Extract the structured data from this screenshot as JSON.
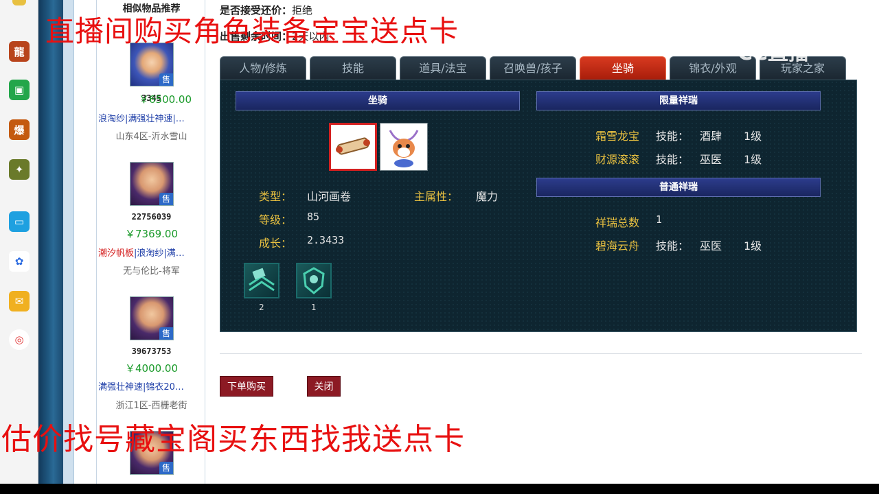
{
  "similar": {
    "title": "相似物品推荐",
    "sell_label": "售",
    "items": [
      {
        "id": "3345",
        "price": "￥6500.00",
        "tags_red": "",
        "tags": "浪淘纱|满强壮神速|…",
        "server": "山东4区-沂水雪山"
      },
      {
        "id": "22756039",
        "price": "￥7369.00",
        "tags_red": "潮汐帆板",
        "tags": "|浪淘纱|满…",
        "server": "无与伦比-将军"
      },
      {
        "id": "39673753",
        "price": "￥4000.00",
        "tags_red": "",
        "tags": "满强壮神速|锦衣20…",
        "server": "浙江1区-西栅老街"
      }
    ]
  },
  "header": {
    "bargain_label": "是否接受还价：",
    "bargain_value": "拒绝",
    "remain_label": "出售剩余时间：",
    "remain_value": "2天以内"
  },
  "tabs": [
    "人物/修炼",
    "技能",
    "道具/法宝",
    "召唤兽/孩子",
    "坐骑",
    "锦衣/外观",
    "玩家之家"
  ],
  "active_tab": "坐骑",
  "mount": {
    "section_title": "坐骑",
    "type_label": "类型：",
    "type_value": "山河画卷",
    "attr_label": "主属性：",
    "attr_value": "魔力",
    "level_label": "等级：",
    "level_value": "85",
    "growth_label": "成长：",
    "growth_value": "2.3433",
    "equip_counts": [
      "2",
      "1"
    ]
  },
  "limited": {
    "section_title": "限量祥瑞",
    "items": [
      {
        "name": "霜雪龙宝",
        "skill_label": "技能：",
        "skill": "酒肆",
        "level": "1级"
      },
      {
        "name": "财源滚滚",
        "skill_label": "技能：",
        "skill": "巫医",
        "level": "1级"
      }
    ]
  },
  "normal": {
    "section_title": "普通祥瑞",
    "total_label": "祥瑞总数",
    "total_value": "1",
    "items": [
      {
        "name": "碧海云舟",
        "skill_label": "技能：",
        "skill": "巫医",
        "level": "1级"
      }
    ]
  },
  "buttons": {
    "order": "下单购买",
    "close": "关闭"
  },
  "overlay": {
    "top_text": "直播间购买角色装备宝宝送点卡",
    "bottom_text": "估价找号藏宝阁买东西找我送点卡",
    "watermark": "CC直播"
  },
  "colors": {
    "active_tab": "#c42a12",
    "label_yellow": "#e8c040",
    "price_green": "#1a9a2a",
    "overlay_red": "#e81010"
  }
}
